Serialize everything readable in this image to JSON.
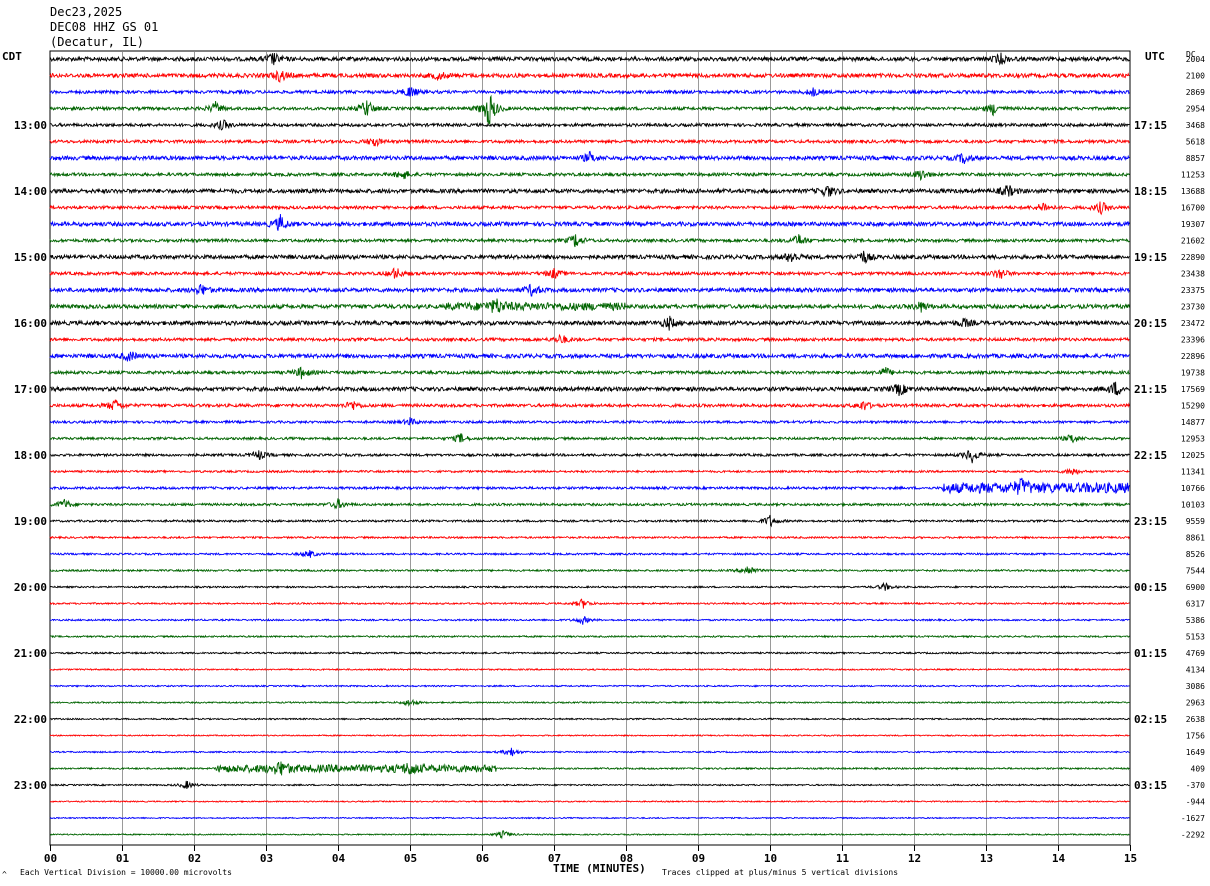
{
  "header": {
    "date": "Dec23,2025",
    "station": "DEC08 HHZ GS 01",
    "location": "(Decatur, IL)"
  },
  "left_zone": "CDT",
  "right_zone": "UTC",
  "right_corner": "DC",
  "footer": {
    "scale": "Each Vertical Division = 10000.00 microvolts",
    "clip": "Traces clipped at plus/minus 5 vertical divisions",
    "corner_mark": "^"
  },
  "colors": {
    "trace_cycle": [
      "#000000",
      "#ff0000",
      "#0000ff",
      "#006400"
    ],
    "grid": "#808080"
  },
  "chart_data": {
    "type": "line",
    "title": "DEC08 HHZ GS 01",
    "xlabel": "TIME (MINUTES)",
    "xlim": [
      0,
      15
    ],
    "x_ticks": [
      "00",
      "01",
      "02",
      "03",
      "04",
      "05",
      "06",
      "07",
      "08",
      "09",
      "10",
      "11",
      "12",
      "13",
      "14",
      "15"
    ],
    "trace_count": 48,
    "left_time_labels": [
      {
        "trace": 4,
        "label": "13:00"
      },
      {
        "trace": 8,
        "label": "14:00"
      },
      {
        "trace": 12,
        "label": "15:00"
      },
      {
        "trace": 16,
        "label": "16:00"
      },
      {
        "trace": 20,
        "label": "17:00"
      },
      {
        "trace": 24,
        "label": "18:00"
      },
      {
        "trace": 28,
        "label": "19:00"
      },
      {
        "trace": 32,
        "label": "20:00"
      },
      {
        "trace": 36,
        "label": "21:00"
      },
      {
        "trace": 40,
        "label": "22:00"
      },
      {
        "trace": 44,
        "label": "23:00"
      }
    ],
    "right_time_labels": [
      {
        "trace": 4,
        "label": "17:15"
      },
      {
        "trace": 8,
        "label": "18:15"
      },
      {
        "trace": 12,
        "label": "19:15"
      },
      {
        "trace": 16,
        "label": "20:15"
      },
      {
        "trace": 20,
        "label": "21:15"
      },
      {
        "trace": 24,
        "label": "22:15"
      },
      {
        "trace": 28,
        "label": "23:15"
      },
      {
        "trace": 32,
        "label": "00:15"
      },
      {
        "trace": 36,
        "label": "01:15"
      },
      {
        "trace": 40,
        "label": "02:15"
      },
      {
        "trace": 44,
        "label": "03:15"
      }
    ],
    "trace_offsets": [
      "2004",
      "2100",
      "2869",
      "2954",
      "3468",
      "5618",
      "8857",
      "11253",
      "13688",
      "16700",
      "19307",
      "21602",
      "22890",
      "23438",
      "23375",
      "23730",
      "23472",
      "23396",
      "22896",
      "19738",
      "17569",
      "15290",
      "14877",
      "12953",
      "12025",
      "11341",
      "10766",
      "10103",
      "9559",
      "8861",
      "8526",
      "7544",
      "6900",
      "6317",
      "5386",
      "5153",
      "4769",
      "4134",
      "3086",
      "2963",
      "2638",
      "1756",
      "1649",
      "409",
      "-370",
      "-944",
      "-1627",
      "-2292"
    ],
    "trace_activity": [
      2,
      2,
      1.5,
      1.5,
      1.5,
      1.5,
      2,
      1.5,
      2,
      1.5,
      2,
      1.5,
      2,
      1.5,
      2,
      2,
      2,
      1.5,
      2,
      1.5,
      2,
      1.5,
      1.2,
      1.2,
      1.2,
      1,
      1.2,
      1.2,
      1,
      0.9,
      0.9,
      0.9,
      0.8,
      0.8,
      0.8,
      0.8,
      0.8,
      0.7,
      0.7,
      0.7,
      0.7,
      0.6,
      0.7,
      0.8,
      0.7,
      0.6,
      0.6,
      0.6
    ],
    "events": [
      {
        "trace": 0,
        "minute": 3.1,
        "amp": 6
      },
      {
        "trace": 0,
        "minute": 13.2,
        "amp": 5
      },
      {
        "trace": 1,
        "minute": 3.2,
        "amp": 6
      },
      {
        "trace": 1,
        "minute": 5.4,
        "amp": 4
      },
      {
        "trace": 2,
        "minute": 5.0,
        "amp": 6
      },
      {
        "trace": 2,
        "minute": 10.6,
        "amp": 4
      },
      {
        "trace": 3,
        "minute": 2.3,
        "amp": 6
      },
      {
        "trace": 3,
        "minute": 4.4,
        "amp": 9
      },
      {
        "trace": 3,
        "minute": 6.1,
        "amp": 18
      },
      {
        "trace": 3,
        "minute": 13.1,
        "amp": 6
      },
      {
        "trace": 4,
        "minute": 2.4,
        "amp": 5
      },
      {
        "trace": 5,
        "minute": 4.5,
        "amp": 5
      },
      {
        "trace": 6,
        "minute": 7.5,
        "amp": 5
      },
      {
        "trace": 6,
        "minute": 12.7,
        "amp": 5
      },
      {
        "trace": 7,
        "minute": 4.9,
        "amp": 5
      },
      {
        "trace": 7,
        "minute": 12.1,
        "amp": 6
      },
      {
        "trace": 8,
        "minute": 10.8,
        "amp": 6
      },
      {
        "trace": 8,
        "minute": 13.3,
        "amp": 6
      },
      {
        "trace": 9,
        "minute": 13.8,
        "amp": 5
      },
      {
        "trace": 9,
        "minute": 14.6,
        "amp": 6
      },
      {
        "trace": 10,
        "minute": 3.2,
        "amp": 8
      },
      {
        "trace": 11,
        "minute": 7.3,
        "amp": 7
      },
      {
        "trace": 11,
        "minute": 10.4,
        "amp": 6
      },
      {
        "trace": 12,
        "minute": 10.3,
        "amp": 6
      },
      {
        "trace": 12,
        "minute": 11.3,
        "amp": 6
      },
      {
        "trace": 13,
        "minute": 4.8,
        "amp": 6
      },
      {
        "trace": 13,
        "minute": 7.0,
        "amp": 5
      },
      {
        "trace": 13,
        "minute": 13.2,
        "amp": 6
      },
      {
        "trace": 14,
        "minute": 2.1,
        "amp": 6
      },
      {
        "trace": 14,
        "minute": 6.7,
        "amp": 6
      },
      {
        "trace": 15,
        "minute": 6.2,
        "amp": 6
      },
      {
        "trace": 15,
        "minute": 12.1,
        "amp": 5
      },
      {
        "trace": 16,
        "minute": 8.6,
        "amp": 6
      },
      {
        "trace": 16,
        "minute": 12.7,
        "amp": 4
      },
      {
        "trace": 17,
        "minute": 7.1,
        "amp": 5
      },
      {
        "trace": 18,
        "minute": 1.1,
        "amp": 5
      },
      {
        "trace": 19,
        "minute": 3.5,
        "amp": 6
      },
      {
        "trace": 19,
        "minute": 11.6,
        "amp": 5
      },
      {
        "trace": 20,
        "minute": 11.8,
        "amp": 6
      },
      {
        "trace": 20,
        "minute": 14.8,
        "amp": 7
      },
      {
        "trace": 21,
        "minute": 0.9,
        "amp": 6
      },
      {
        "trace": 21,
        "minute": 4.2,
        "amp": 5
      },
      {
        "trace": 21,
        "minute": 11.3,
        "amp": 5
      },
      {
        "trace": 22,
        "minute": 5.0,
        "amp": 4
      },
      {
        "trace": 23,
        "minute": 5.7,
        "amp": 5
      },
      {
        "trace": 23,
        "minute": 14.2,
        "amp": 5
      },
      {
        "trace": 24,
        "minute": 2.9,
        "amp": 5
      },
      {
        "trace": 24,
        "minute": 12.8,
        "amp": 8
      },
      {
        "trace": 25,
        "minute": 14.2,
        "amp": 4
      },
      {
        "trace": 26,
        "minute": 13.5,
        "amp": 6
      },
      {
        "trace": 27,
        "minute": 0.2,
        "amp": 5
      },
      {
        "trace": 27,
        "minute": 4.0,
        "amp": 5
      },
      {
        "trace": 28,
        "minute": 10.0,
        "amp": 6
      },
      {
        "trace": 30,
        "minute": 3.6,
        "amp": 4
      },
      {
        "trace": 31,
        "minute": 9.7,
        "amp": 6
      },
      {
        "trace": 32,
        "minute": 11.6,
        "amp": 4
      },
      {
        "trace": 33,
        "minute": 7.4,
        "amp": 5
      },
      {
        "trace": 34,
        "minute": 7.4,
        "amp": 4
      },
      {
        "trace": 39,
        "minute": 5.0,
        "amp": 4
      },
      {
        "trace": 42,
        "minute": 6.4,
        "amp": 5
      },
      {
        "trace": 43,
        "minute": 3.2,
        "amp": 6
      },
      {
        "trace": 43,
        "minute": 5.0,
        "amp": 5
      },
      {
        "trace": 44,
        "minute": 1.9,
        "amp": 4
      },
      {
        "trace": 47,
        "minute": 6.3,
        "amp": 4
      }
    ],
    "broadband_windows": [
      {
        "trace": 26,
        "from": 12.4,
        "to": 15,
        "amp": 4
      },
      {
        "trace": 43,
        "from": 2.3,
        "to": 6.2,
        "amp": 3
      },
      {
        "trace": 15,
        "from": 5.5,
        "to": 8.0,
        "amp": 2
      }
    ]
  }
}
